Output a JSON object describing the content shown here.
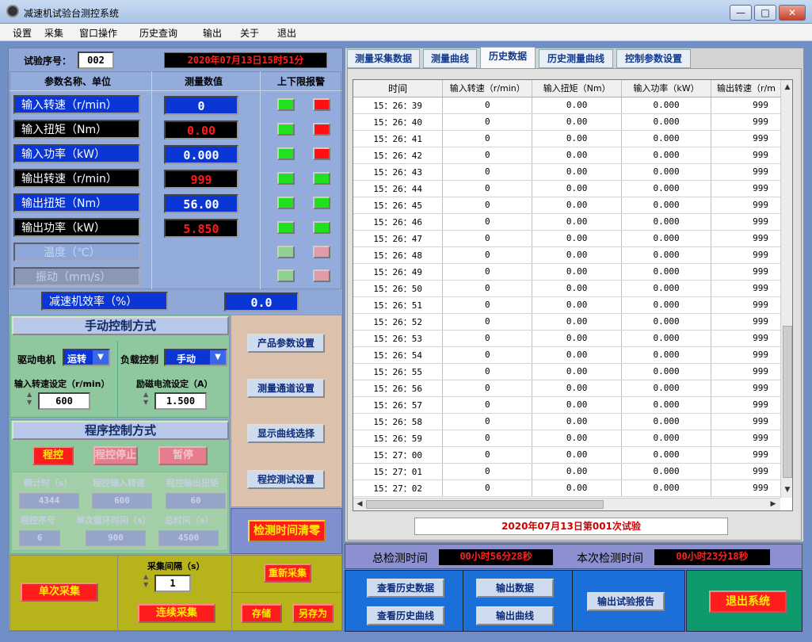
{
  "window": {
    "title": "减速机试验台测控系统",
    "min": "—",
    "max": "□",
    "close": "✕"
  },
  "menu": [
    "设置",
    "采集",
    "窗口操作",
    "历史查询",
    "输出",
    "关于",
    "退出"
  ],
  "header": {
    "test_no_label": "试验序号：",
    "test_no": "002",
    "datetime": "2020年07月13日15时51分"
  },
  "table_head": {
    "name": "参数名称、单位",
    "value": "测量数值",
    "alarm": "上下限报警"
  },
  "params": [
    {
      "label": "输入转速（r/min）",
      "value": "0"
    },
    {
      "label": "输入扭矩（Nm）",
      "value": "0.00"
    },
    {
      "label": "输入功率（kW）",
      "value": "0.000"
    },
    {
      "label": "输出转速（r/min）",
      "value": "999"
    },
    {
      "label": "输出扭矩（Nm）",
      "value": "56.00"
    },
    {
      "label": "输出功率（kW）",
      "value": "5.850"
    },
    {
      "label": "温度（℃）",
      "value": ""
    },
    {
      "label": "振动（mm/s）",
      "value": ""
    }
  ],
  "efficiency": {
    "label": "减速机效率（%）",
    "value": "0.0"
  },
  "manual": {
    "title": "手动控制方式",
    "drive_label": "驱动电机",
    "drive_value": "运转",
    "load_label": "负载控制",
    "load_value": "手动",
    "speed_label": "输入转速设定（r/min）",
    "speed_value": "600",
    "current_label": "励磁电流设定（A）",
    "current_value": "1.500"
  },
  "settings_buttons": [
    "产品参数设置",
    "测量通道设置",
    "显示曲线选择",
    "程控测试设置"
  ],
  "program": {
    "title": "程序控制方式",
    "btn_start": "程控",
    "btn_stop": "程控停止",
    "btn_pause": "暂停",
    "countdown_label": "倒计时（s）",
    "countdown": "4344",
    "in_speed_label": "程控输入转速",
    "in_speed": "600",
    "out_torque_label": "程控输出扭矩",
    "out_torque": "60",
    "seq_label": "程控序号",
    "seq": "6",
    "cycle_label": "单次循环时间（s）",
    "cycle": "900",
    "total_label": "总时间（s）",
    "total": "4500"
  },
  "clear_btn": "检测时间清零",
  "acq": {
    "single": "单次采集",
    "interval_label": "采集间隔（s）",
    "interval": "1",
    "continuous": "连续采集",
    "reacq": "重新采集",
    "save": "存储",
    "saveas": "另存为"
  },
  "tabs": [
    "测量采集数据",
    "测量曲线",
    "历史数据",
    "历史测量曲线",
    "控制参数设置"
  ],
  "grid": {
    "columns": [
      "时间",
      "输入转速（r/min）",
      "输入扭矩（Nm）",
      "输入功率（kW）",
      "输出转速（r/m"
    ],
    "rows": [
      [
        "15：26：39",
        "0",
        "0.00",
        "0.000",
        "999"
      ],
      [
        "15：26：40",
        "0",
        "0.00",
        "0.000",
        "999"
      ],
      [
        "15：26：41",
        "0",
        "0.00",
        "0.000",
        "999"
      ],
      [
        "15：26：42",
        "0",
        "0.00",
        "0.000",
        "999"
      ],
      [
        "15：26：43",
        "0",
        "0.00",
        "0.000",
        "999"
      ],
      [
        "15：26：44",
        "0",
        "0.00",
        "0.000",
        "999"
      ],
      [
        "15：26：45",
        "0",
        "0.00",
        "0.000",
        "999"
      ],
      [
        "15：26：46",
        "0",
        "0.00",
        "0.000",
        "999"
      ],
      [
        "15：26：47",
        "0",
        "0.00",
        "0.000",
        "999"
      ],
      [
        "15：26：48",
        "0",
        "0.00",
        "0.000",
        "999"
      ],
      [
        "15：26：49",
        "0",
        "0.00",
        "0.000",
        "999"
      ],
      [
        "15：26：50",
        "0",
        "0.00",
        "0.000",
        "999"
      ],
      [
        "15：26：51",
        "0",
        "0.00",
        "0.000",
        "999"
      ],
      [
        "15：26：52",
        "0",
        "0.00",
        "0.000",
        "999"
      ],
      [
        "15：26：53",
        "0",
        "0.00",
        "0.000",
        "999"
      ],
      [
        "15：26：54",
        "0",
        "0.00",
        "0.000",
        "999"
      ],
      [
        "15：26：55",
        "0",
        "0.00",
        "0.000",
        "999"
      ],
      [
        "15：26：56",
        "0",
        "0.00",
        "0.000",
        "999"
      ],
      [
        "15：26：57",
        "0",
        "0.00",
        "0.000",
        "999"
      ],
      [
        "15：26：58",
        "0",
        "0.00",
        "0.000",
        "999"
      ],
      [
        "15：26：59",
        "0",
        "0.00",
        "0.000",
        "999"
      ],
      [
        "15：27：00",
        "0",
        "0.00",
        "0.000",
        "999"
      ],
      [
        "15：27：01",
        "0",
        "0.00",
        "0.000",
        "999"
      ],
      [
        "15：27：02",
        "0",
        "0.00",
        "0.000",
        "999"
      ]
    ]
  },
  "test_caption": "2020年07月13日第001次试验",
  "totals": {
    "total_label": "总检测时间",
    "total_value": "00小时56分28秒",
    "this_label": "本次检测时间",
    "this_value": "00小时23分18秒"
  },
  "bottom_buttons": {
    "view_history": "查看历史数据",
    "view_curve": "查看历史曲线",
    "export_data": "输出数据",
    "export_curve": "输出曲线",
    "export_report": "输出试验报告",
    "exit": "退出系统"
  }
}
